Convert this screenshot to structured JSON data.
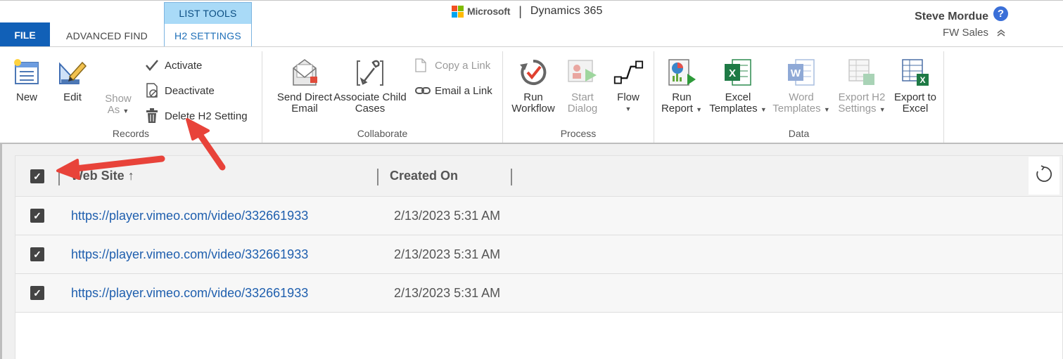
{
  "header": {
    "tabs": {
      "file": "FILE",
      "advanced_find": "ADVANCED FIND",
      "context_group": "LIST TOOLS",
      "context_tab": "H2 SETTINGS"
    },
    "brand": {
      "microsoft": "Microsoft",
      "separator": "|",
      "product": "Dynamics 365"
    },
    "user": {
      "name": "Steve Mordue",
      "org": "FW Sales",
      "help_glyph": "?"
    }
  },
  "ribbon": {
    "records": {
      "label": "Records",
      "new": "New",
      "edit": "Edit",
      "show_as_1": "Show",
      "show_as_2": "As",
      "activate": "Activate",
      "deactivate": "Deactivate",
      "delete": "Delete H2 Setting"
    },
    "collaborate": {
      "label": "Collaborate",
      "send_email_1": "Send Direct",
      "send_email_2": "Email",
      "assoc_1": "Associate Child",
      "assoc_2": "Cases",
      "copy_link": "Copy a Link",
      "email_link": "Email a Link"
    },
    "process": {
      "label": "Process",
      "run_workflow_1": "Run",
      "run_workflow_2": "Workflow",
      "start_dialog_1": "Start",
      "start_dialog_2": "Dialog",
      "flow": "Flow"
    },
    "data": {
      "label": "Data",
      "run_report_1": "Run",
      "run_report_2": "Report",
      "excel_templates_1": "Excel",
      "excel_templates_2": "Templates",
      "word_templates_1": "Word",
      "word_templates_2": "Templates",
      "export_h2_1": "Export H2",
      "export_h2_2": "Settings",
      "export_excel_1": "Export to",
      "export_excel_2": "Excel"
    }
  },
  "grid": {
    "columns": [
      "Web Site",
      "Created On"
    ],
    "sort_glyph": "↑",
    "rows": [
      {
        "web_site": "https://player.vimeo.com/video/332661933",
        "created_on": "2/13/2023 5:31 AM",
        "checked": true
      },
      {
        "web_site": "https://player.vimeo.com/video/332661933",
        "created_on": "2/13/2023 5:31 AM",
        "checked": true
      },
      {
        "web_site": "https://player.vimeo.com/video/332661933",
        "created_on": "2/13/2023 5:31 AM",
        "checked": true
      }
    ]
  },
  "colors": {
    "file_tab": "#1160b7",
    "context_title_bg": "#a9daf7",
    "link": "#1f5fae",
    "annotation_arrow": "#e8433a",
    "ms_red": "#f25022",
    "ms_green": "#7fba00",
    "ms_blue": "#00a4ef",
    "ms_yellow": "#ffb900"
  },
  "icons": [
    "new-icon",
    "edit-icon",
    "show-as-icon",
    "checkmark-icon",
    "deactivate-icon",
    "trash-icon",
    "send-email-icon",
    "associate-icon",
    "copy-link-icon",
    "chain-link-icon",
    "run-workflow-icon",
    "start-dialog-icon",
    "flow-icon",
    "run-report-icon",
    "excel-icon",
    "word-icon",
    "export-h2-icon",
    "export-excel-icon",
    "refresh-icon",
    "help-icon"
  ]
}
